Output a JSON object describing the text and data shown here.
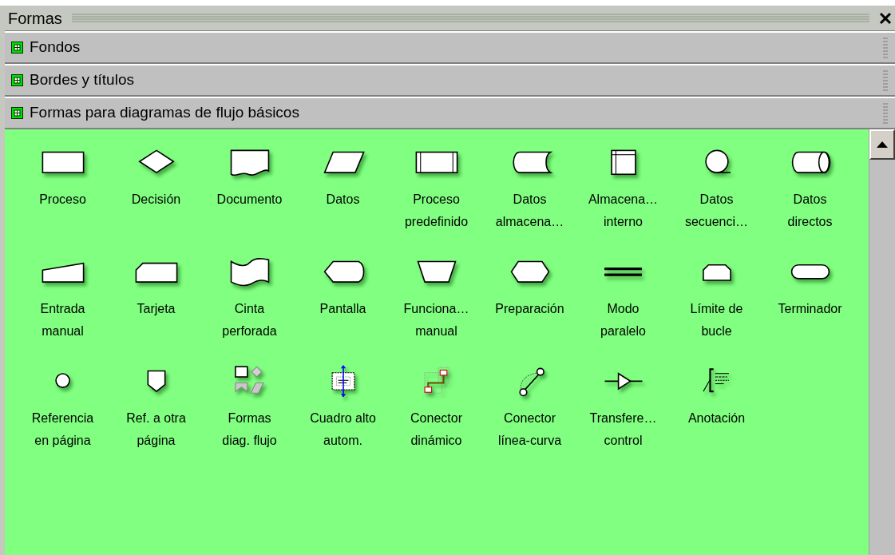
{
  "panel": {
    "title": "Formas"
  },
  "stencils": [
    {
      "title": "Fondos"
    },
    {
      "title": "Bordes y títulos"
    },
    {
      "title": "Formas para diagramas de flujo básicos"
    }
  ],
  "shapes": [
    {
      "kind": "process",
      "lines": [
        "Proceso"
      ]
    },
    {
      "kind": "decision",
      "lines": [
        "Decisión"
      ]
    },
    {
      "kind": "document",
      "lines": [
        "Documento"
      ]
    },
    {
      "kind": "data",
      "lines": [
        "Datos"
      ]
    },
    {
      "kind": "predefined",
      "lines": [
        "Proceso",
        "predefinido"
      ]
    },
    {
      "kind": "stored-data",
      "lines": [
        "Datos",
        "almacena…"
      ]
    },
    {
      "kind": "internal-storage",
      "lines": [
        "Almacena…",
        "interno"
      ]
    },
    {
      "kind": "sequential-data",
      "lines": [
        "Datos",
        "secuenci…"
      ]
    },
    {
      "kind": "direct-data",
      "lines": [
        "Datos",
        "directos"
      ]
    },
    {
      "kind": "manual-input",
      "lines": [
        "Entrada",
        "manual"
      ]
    },
    {
      "kind": "card",
      "lines": [
        "Tarjeta"
      ]
    },
    {
      "kind": "punched-tape",
      "lines": [
        "Cinta",
        "perforada"
      ]
    },
    {
      "kind": "display",
      "lines": [
        "Pantalla"
      ]
    },
    {
      "kind": "manual-operation",
      "lines": [
        "Funciona…",
        "manual"
      ]
    },
    {
      "kind": "preparation",
      "lines": [
        "Preparación"
      ]
    },
    {
      "kind": "parallel-mode",
      "lines": [
        "Modo",
        "paralelo"
      ]
    },
    {
      "kind": "loop-limit",
      "lines": [
        "Límite de",
        "bucle"
      ]
    },
    {
      "kind": "terminator",
      "lines": [
        "Terminador"
      ]
    },
    {
      "kind": "on-page-ref",
      "lines": [
        "Referencia",
        "en página"
      ]
    },
    {
      "kind": "off-page-ref",
      "lines": [
        "Ref. a otra",
        "página"
      ]
    },
    {
      "kind": "flowchart-shapes",
      "lines": [
        "Formas",
        "diag. flujo"
      ]
    },
    {
      "kind": "auto-height-box",
      "lines": [
        "Cuadro alto",
        "autom."
      ]
    },
    {
      "kind": "dynamic-connector",
      "lines": [
        "Conector",
        "dinámico"
      ]
    },
    {
      "kind": "line-curve-connector",
      "lines": [
        "Conector",
        "línea-curva"
      ]
    },
    {
      "kind": "control-transfer",
      "lines": [
        "Transfere…",
        "control"
      ]
    },
    {
      "kind": "annotation",
      "lines": [
        "Anotación"
      ]
    }
  ]
}
